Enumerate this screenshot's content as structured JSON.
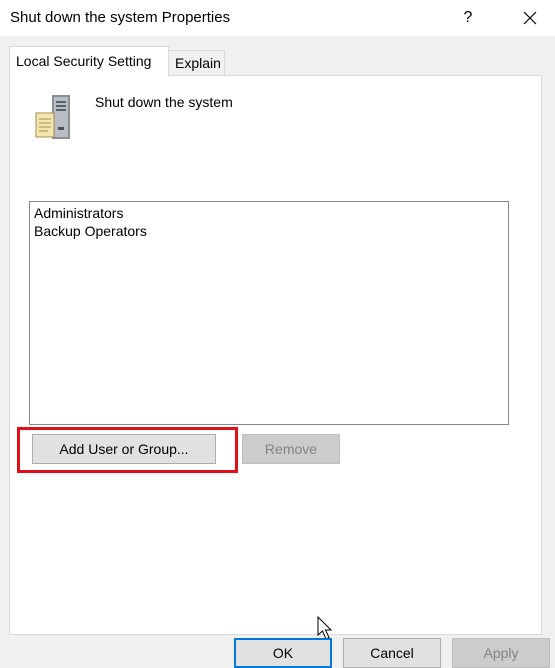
{
  "window": {
    "title": "Shut down the system Properties",
    "help_label": "?"
  },
  "tabs": [
    {
      "label": "Local Security Setting",
      "active": true
    },
    {
      "label": "Explain",
      "active": false
    }
  ],
  "policy": {
    "name": "Shut down the system",
    "icon": "policy-server-icon"
  },
  "list": {
    "items": [
      "Administrators",
      "Backup Operators"
    ]
  },
  "buttons": {
    "add": "Add User or Group...",
    "remove": "Remove",
    "ok": "OK",
    "cancel": "Cancel",
    "apply": "Apply"
  },
  "colors": {
    "highlight": "#e0101a",
    "focus": "#0078d7"
  }
}
